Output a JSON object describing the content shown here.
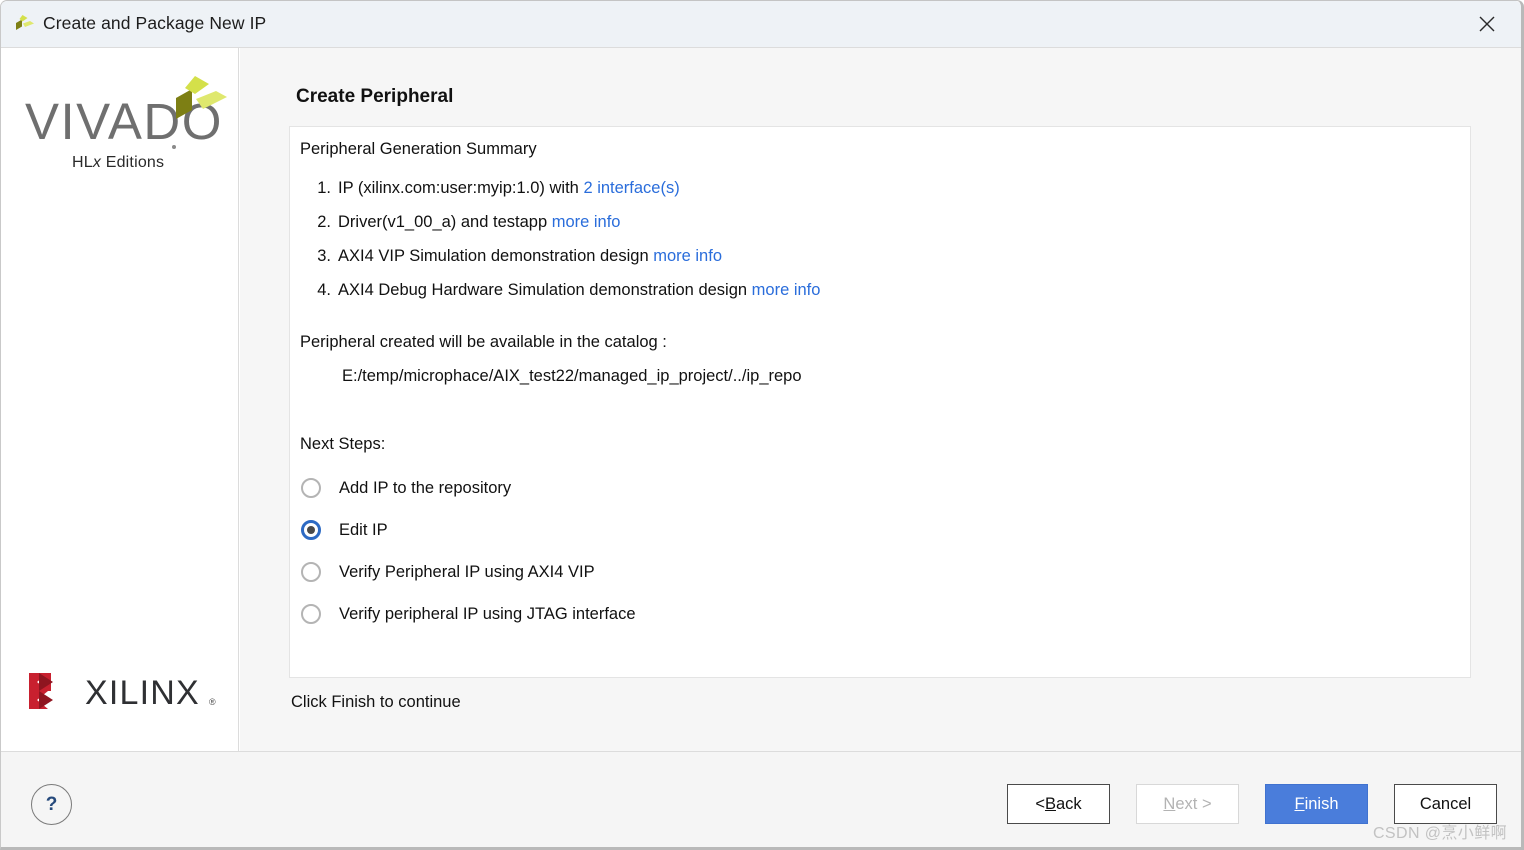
{
  "window": {
    "title": "Create and Package New IP",
    "icon": "vivado-logo-icon",
    "close_icon": "close-icon"
  },
  "sidebar": {
    "product_name": "VIVADO",
    "product_edition_prefix": "HL",
    "product_edition_italic": "x",
    "product_edition_suffix": " Editions",
    "vendor_name": "XILINX",
    "vendor_registered": "®"
  },
  "main": {
    "page_title": "Create Peripheral",
    "summary_heading": "Peripheral Generation Summary",
    "summary_items": [
      {
        "number": "1.",
        "text": "IP (xilinx.com:user:myip:1.0) with ",
        "link": "2 interface(s)",
        "trailing": ""
      },
      {
        "number": "2.",
        "text": "Driver(v1_00_a) and testapp ",
        "link": "more info",
        "trailing": ""
      },
      {
        "number": "3.",
        "text": "AXI4 VIP Simulation demonstration design ",
        "link": "more info",
        "trailing": ""
      },
      {
        "number": "4.",
        "text": "AXI4 Debug Hardware Simulation demonstration design ",
        "link": "more info",
        "trailing": ""
      }
    ],
    "catalog_line": "Peripheral created will be available in the catalog :",
    "catalog_path": "E:/temp/microphace/AIX_test22/managed_ip_project/../ip_repo",
    "next_steps_label": "Next Steps:",
    "next_steps_options": [
      {
        "label": "Add IP to the repository",
        "checked": false
      },
      {
        "label": "Edit IP",
        "checked": true
      },
      {
        "label": "Verify Peripheral IP using AXI4 VIP",
        "checked": false
      },
      {
        "label": "Verify peripheral IP using JTAG interface",
        "checked": false
      }
    ],
    "footer_hint": "Click Finish to continue"
  },
  "footer": {
    "help_label": "?",
    "buttons": [
      {
        "prefix": "< ",
        "accel": "B",
        "suffix": "ack",
        "state": "normal"
      },
      {
        "prefix": "",
        "accel": "N",
        "suffix": "ext >",
        "state": "disabled"
      },
      {
        "prefix": "",
        "accel": "F",
        "suffix": "inish",
        "state": "primary"
      },
      {
        "prefix": "",
        "accel": "",
        "suffix": "Cancel",
        "state": "normal"
      }
    ]
  },
  "watermark": "CSDN @烹小鲜啊",
  "colors": {
    "accent_blue": "#4a7ddb",
    "link_blue": "#2a6ddb",
    "radio_blue": "#2d6ac4",
    "titlebar_bg": "#eef2f6",
    "content_bg": "#f6f6f6",
    "xilinx_red": "#c8202f",
    "vivado_olive": "#7d7f14",
    "vivado_yellow": "#d4e04a",
    "vivado_lime": "#e2e86e"
  }
}
